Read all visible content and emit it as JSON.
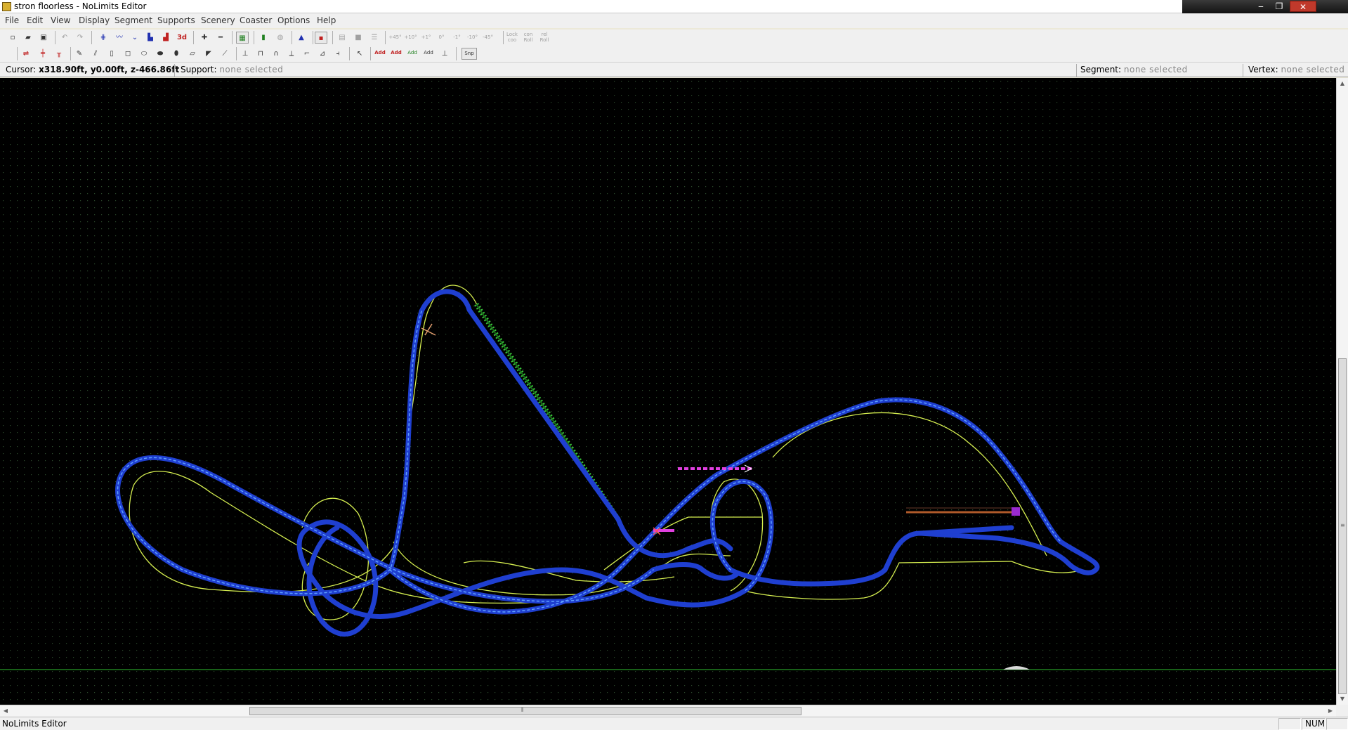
{
  "window": {
    "title": "stron floorless - NoLimits Editor",
    "controls": {
      "minimize": "‒",
      "maximize": "❐",
      "close": "✕"
    }
  },
  "menu": [
    "File",
    "Edit",
    "View",
    "Display",
    "Segment",
    "Supports",
    "Scenery",
    "Coaster",
    "Options",
    "Help"
  ],
  "toolbar1": {
    "labels": {
      "threed": "3d",
      "lock_coo": "Lock\ncoo",
      "roll_con": "con\nRoll",
      "roll_rel": "rel\nRoll"
    },
    "angle_buttons": [
      "+45°",
      "+10°",
      "+1°",
      "0°",
      "-1°",
      "-10°",
      "-45°"
    ]
  },
  "toolbar2": {
    "add_buttons": [
      "Add",
      "Add",
      "Add",
      "Add"
    ],
    "snap_label": "Snp"
  },
  "infobar": {
    "cursor_label": "Cursor:",
    "cursor_value": "x318.90ft, y0.00ft, z-466.86ft",
    "support_label": "Support:",
    "support_value": "none selected",
    "segment_label": "Segment:",
    "segment_value": "none selected",
    "vertex_label": "Vertex:",
    "vertex_value": "none selected"
  },
  "colors": {
    "track": "#1f3fd0",
    "track_highlight": "#5ea0ff",
    "heartline": "#d6ef50",
    "lift_chain": "#39c53a",
    "station": "#e040e0",
    "brakes": "#b05a2a",
    "grid_dots": "#2c4a2c",
    "ground_line": "#2fbf2f"
  },
  "statusbar": {
    "text": "NoLimits Editor",
    "indicator": "NUM"
  }
}
